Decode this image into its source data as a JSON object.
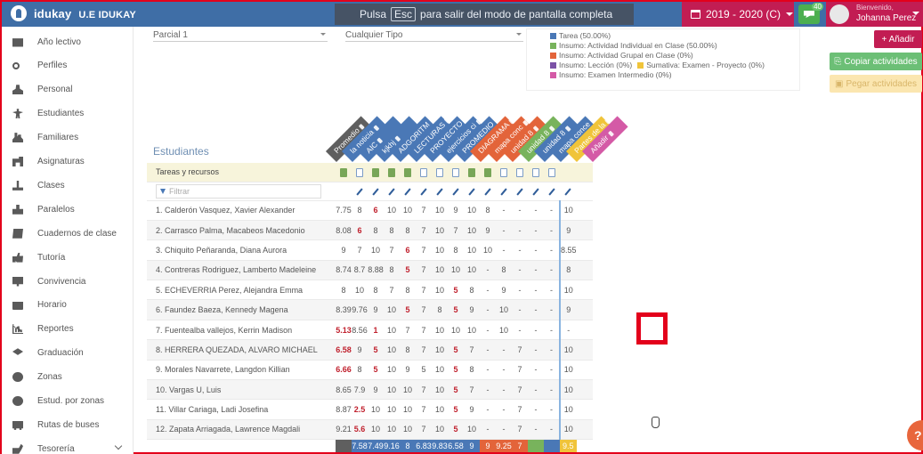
{
  "app": {
    "brand": "idukay",
    "school": "U.E IDUKAY",
    "year_label": "2019 - 2020 (C)",
    "notif_count": "40",
    "user_greeting": "Bienvenido,",
    "user_name": "Johanna Perez",
    "fullscreen_prefix": "Pulsa",
    "fullscreen_key": "Esc",
    "fullscreen_suffix": "para salir del modo de pantalla completa"
  },
  "sidebar": {
    "items": [
      {
        "label": "Año lectivo",
        "icon": "calendar-icon"
      },
      {
        "label": "Perfiles",
        "icon": "key-icon"
      },
      {
        "label": "Personal",
        "icon": "person-icon"
      },
      {
        "label": "Estudiantes",
        "icon": "child-icon"
      },
      {
        "label": "Familiares",
        "icon": "family-icon"
      },
      {
        "label": "Asignaturas",
        "icon": "subjects-icon"
      },
      {
        "label": "Clases",
        "icon": "classes-icon"
      },
      {
        "label": "Paralelos",
        "icon": "groups-icon"
      },
      {
        "label": "Cuadernos de clase",
        "icon": "book-icon"
      },
      {
        "label": "Tutoría",
        "icon": "thumbs-up-icon"
      },
      {
        "label": "Convivencia",
        "icon": "monitor-icon"
      },
      {
        "label": "Horario",
        "icon": "calendar-icon"
      },
      {
        "label": "Reportes",
        "icon": "bar-chart-icon"
      },
      {
        "label": "Graduación",
        "icon": "graduation-cap-icon"
      },
      {
        "label": "Zonas",
        "icon": "globe-icon"
      },
      {
        "label": "Estud. por zonas",
        "icon": "globe-icon"
      },
      {
        "label": "Rutas de buses",
        "icon": "bus-icon"
      },
      {
        "label": "Tesorería",
        "icon": "money-icon"
      }
    ]
  },
  "filters": {
    "period": "Parcial 1",
    "type": "Cualquier Tipo"
  },
  "legend": {
    "items": [
      {
        "label": "Tarea (50.00%)",
        "color": "#4a78b6"
      },
      {
        "label": "Insumo: Actividad Individual en Clase (50.00%)",
        "color": "#78b35c"
      },
      {
        "label": "Insumo: Actividad Grupal en Clase (0%)",
        "color": "#e3643a"
      },
      {
        "label": "Insumo: Lección (0%)",
        "color": "#7b52a6"
      },
      {
        "label": "Sumativa: Examen - Proyecto (0%)",
        "color": "#f0c43a"
      },
      {
        "label": "Insumo: Examen Intermedio (0%)",
        "color": "#d45aa6"
      }
    ]
  },
  "buttons": {
    "add": "+ Añadir",
    "copy": "Copiar actividades",
    "paste": "Pegar actividades"
  },
  "grades": {
    "title": "Estudiantes",
    "resources_label": "Tareas y recursos",
    "filter_placeholder": "Filtrar",
    "columns": [
      {
        "label": "Promedio",
        "color": "#5f5f5f"
      },
      {
        "label": "la noticia",
        "color": "#4a78b6"
      },
      {
        "label": "AIC",
        "color": "#4a78b6"
      },
      {
        "label": "kjkhj",
        "color": "#4a78b6"
      },
      {
        "label": "ADGORITM",
        "color": "#4a78b6"
      },
      {
        "label": "LECTURAS I",
        "color": "#4a78b6"
      },
      {
        "label": "PROYECTO",
        "color": "#4a78b6"
      },
      {
        "label": "ejercicios ci",
        "color": "#4a78b6"
      },
      {
        "label": "PROMEDIO",
        "color": "#4a78b6"
      },
      {
        "label": "DIAGRAMA",
        "color": "#e3643a"
      },
      {
        "label": "mapa conc",
        "color": "#e3643a"
      },
      {
        "label": "unidad 8",
        "color": "#e3643a"
      },
      {
        "label": "unidad 8",
        "color": "#78b35c"
      },
      {
        "label": "unidad 8",
        "color": "#4a78b6"
      },
      {
        "label": "mapa conce",
        "color": "#4a78b6"
      },
      {
        "label": "Partes de la",
        "color": "#f0c43a"
      },
      {
        "label": "Añadir",
        "color": "#d45aa6"
      }
    ],
    "students": [
      {
        "name": "1. Calderón Vasquez, Xavier Alexander",
        "avg": "7.75",
        "cells": [
          "8",
          "6",
          "10",
          "10",
          "7",
          "10",
          "9",
          "10",
          "8",
          "-",
          "-",
          "-",
          "-",
          "10"
        ]
      },
      {
        "name": "2. Carrasco Palma, Macabeos Macedonio",
        "avg": "8.08",
        "cells": [
          "6",
          "8",
          "8",
          "8",
          "7",
          "10",
          "7",
          "10",
          "9",
          "-",
          "-",
          "-",
          "-",
          "9"
        ]
      },
      {
        "name": "3. Chiquito Peñaranda, Diana Aurora",
        "avg": "9",
        "cells": [
          "7",
          "10",
          "7",
          "6",
          "7",
          "10",
          "8",
          "10",
          "10",
          "-",
          "-",
          "-",
          "-",
          "8.55"
        ]
      },
      {
        "name": "4. Contreras Rodriguez, Lamberto Madeleine",
        "avg": "8.74",
        "cells": [
          "8.7",
          "8.88",
          "8",
          "5",
          "7",
          "10",
          "10",
          "10",
          "-",
          "8",
          "-",
          "-",
          "-",
          "8"
        ]
      },
      {
        "name": "5. ECHEVERRIA Perez, Alejandra Emma",
        "avg": "8",
        "cells": [
          "10",
          "8",
          "7",
          "8",
          "7",
          "10",
          "5",
          "8",
          "-",
          "9",
          "-",
          "-",
          "-",
          "10"
        ]
      },
      {
        "name": "6. Faundez Baeza, Kennedy Magena",
        "avg": "8.39",
        "cells": [
          "9.76",
          "9",
          "10",
          "5",
          "7",
          "8",
          "5",
          "9",
          "-",
          "10",
          "-",
          "-",
          "-",
          "9"
        ]
      },
      {
        "name": "7. Fuentealba vallejos, Kerrin Madison",
        "avg": "5.13",
        "cells": [
          "8.56",
          "1",
          "10",
          "7",
          "7",
          "10",
          "10",
          "10",
          "-",
          "10",
          "-",
          "-",
          "-",
          "-"
        ]
      },
      {
        "name": "8. HERRERA QUEZADA, ALVARO MICHAEL",
        "avg": "6.58",
        "cells": [
          "9",
          "5",
          "10",
          "8",
          "7",
          "10",
          "5",
          "7",
          "-",
          "-",
          "7",
          "-",
          "-",
          "10"
        ]
      },
      {
        "name": "9. Morales Navarrete, Langdon Killian",
        "avg": "6.66",
        "cells": [
          "8",
          "5",
          "10",
          "9",
          "5",
          "10",
          "5",
          "8",
          "-",
          "-",
          "7",
          "-",
          "-",
          "10"
        ]
      },
      {
        "name": "10. Vargas U, Luis",
        "avg": "8.65",
        "cells": [
          "7.9",
          "9",
          "10",
          "10",
          "7",
          "10",
          "5",
          "7",
          "-",
          "-",
          "7",
          "-",
          "-",
          "10"
        ]
      },
      {
        "name": "11. Villar Cariaga, Ladi Josefina",
        "avg": "8.87",
        "cells": [
          "2.5",
          "10",
          "10",
          "10",
          "7",
          "10",
          "5",
          "9",
          "-",
          "-",
          "7",
          "-",
          "-",
          "10"
        ]
      },
      {
        "name": "12. Zapata Arriagada, Lawrence Magdali",
        "avg": "9.21",
        "cells": [
          "5.6",
          "10",
          "10",
          "10",
          "7",
          "10",
          "5",
          "10",
          "-",
          "-",
          "7",
          "-",
          "-",
          "10"
        ]
      }
    ],
    "averages": [
      "",
      "7.58",
      "7.49",
      "9.16",
      "8",
      "6.83",
      "9.83",
      "6.58",
      "9",
      "9",
      "9.25",
      "7",
      "",
      "",
      "9.5"
    ],
    "help_label": "?"
  }
}
